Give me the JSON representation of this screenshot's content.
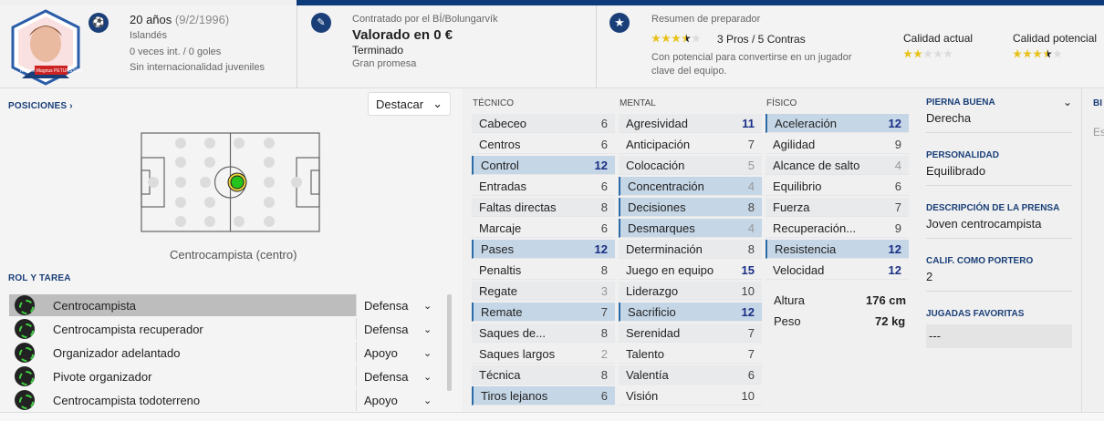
{
  "header": {
    "player_name_on_photo": "Kristinn Magnus PETURSSON",
    "age": "20 años",
    "birthdate": "(9/2/1996)",
    "nationality": "Islandés",
    "caps": "0 veces int. / 0 goles",
    "youth_caps": "Sin internacionalidad juveniles",
    "contract_label": "Contratado por el BÍ/Bolungarvík",
    "value": "Valorado en 0 €",
    "contract_status": "Terminado",
    "prospect": "Gran promesa",
    "coach_report_label": "Resumen de preparador",
    "pros_cons": "3 Pros / 5 Contras",
    "report_text_1": "Con potencial para convertirse en un jugador",
    "report_text_2": "clave del equipo.",
    "current_ability_label": "Calidad actual",
    "potential_ability_label": "Calidad potencial",
    "report_stars": 3.5,
    "current_stars": 2,
    "potential_stars": 3.5
  },
  "positions": {
    "title": "POSICIONES",
    "chevron": "›",
    "highlight_label": "Destacar",
    "position_name": "Centrocampista (centro)"
  },
  "roles": {
    "title": "ROL Y TAREA",
    "items": [
      {
        "name": "Centrocampista",
        "duty": "Defensa"
      },
      {
        "name": "Centrocampista recuperador",
        "duty": "Defensa"
      },
      {
        "name": "Organizador adelantado",
        "duty": "Apoyo"
      },
      {
        "name": "Pivote organizador",
        "duty": "Defensa"
      },
      {
        "name": "Centrocampista todoterreno",
        "duty": "Apoyo"
      }
    ]
  },
  "attributes": {
    "tecnico_label": "TÉCNICO",
    "mental_label": "MENTAL",
    "fisico_label": "FÍSICO",
    "tecnico": [
      {
        "name": "Cabeceo",
        "value": "6"
      },
      {
        "name": "Centros",
        "value": "6"
      },
      {
        "name": "Control",
        "value": "12"
      },
      {
        "name": "Entradas",
        "value": "6"
      },
      {
        "name": "Faltas directas",
        "value": "8"
      },
      {
        "name": "Marcaje",
        "value": "6"
      },
      {
        "name": "Pases",
        "value": "12"
      },
      {
        "name": "Penaltis",
        "value": "8"
      },
      {
        "name": "Regate",
        "value": "3"
      },
      {
        "name": "Remate",
        "value": "7"
      },
      {
        "name": "Saques de...",
        "value": "8"
      },
      {
        "name": "Saques largos",
        "value": "2"
      },
      {
        "name": "Técnica",
        "value": "8"
      },
      {
        "name": "Tiros lejanos",
        "value": "6"
      }
    ],
    "mental": [
      {
        "name": "Agresividad",
        "value": "11"
      },
      {
        "name": "Anticipación",
        "value": "7"
      },
      {
        "name": "Colocación",
        "value": "5"
      },
      {
        "name": "Concentración",
        "value": "4"
      },
      {
        "name": "Decisiones",
        "value": "8"
      },
      {
        "name": "Desmarques",
        "value": "4"
      },
      {
        "name": "Determinación",
        "value": "8"
      },
      {
        "name": "Juego en equipo",
        "value": "15"
      },
      {
        "name": "Liderazgo",
        "value": "10"
      },
      {
        "name": "Sacrificio",
        "value": "12"
      },
      {
        "name": "Serenidad",
        "value": "7"
      },
      {
        "name": "Talento",
        "value": "7"
      },
      {
        "name": "Valentía",
        "value": "6"
      },
      {
        "name": "Visión",
        "value": "10"
      }
    ],
    "fisico": [
      {
        "name": "Aceleración",
        "value": "12"
      },
      {
        "name": "Agilidad",
        "value": "9"
      },
      {
        "name": "Alcance de salto",
        "value": "4"
      },
      {
        "name": "Equilibrio",
        "value": "6"
      },
      {
        "name": "Fuerza",
        "value": "7"
      },
      {
        "name": "Recuperación...",
        "value": "9"
      },
      {
        "name": "Resistencia",
        "value": "12"
      },
      {
        "name": "Velocidad",
        "value": "12"
      }
    ],
    "height_label": "Altura",
    "height": "176 cm",
    "weight_label": "Peso",
    "weight": "72 kg"
  },
  "details": {
    "foot_label": "PIERNA BUENA",
    "foot": "Derecha",
    "personality_label": "PERSONALIDAD",
    "personality": "Equilibrado",
    "press_label": "DESCRIPCIÓN DE LA PRENSA",
    "press": "Joven centrocampista",
    "gk_label": "CALIF. COMO PORTERO",
    "gk": "2",
    "moves_label": "JUGADAS FAVORITAS",
    "moves": "---",
    "far_label": "BI",
    "far_text": "Es"
  },
  "colors": {
    "accent": "#1a3f78",
    "highlight_row": "#c5d6e6",
    "star": "#e8c21b",
    "position_dot": "#24c41d"
  }
}
